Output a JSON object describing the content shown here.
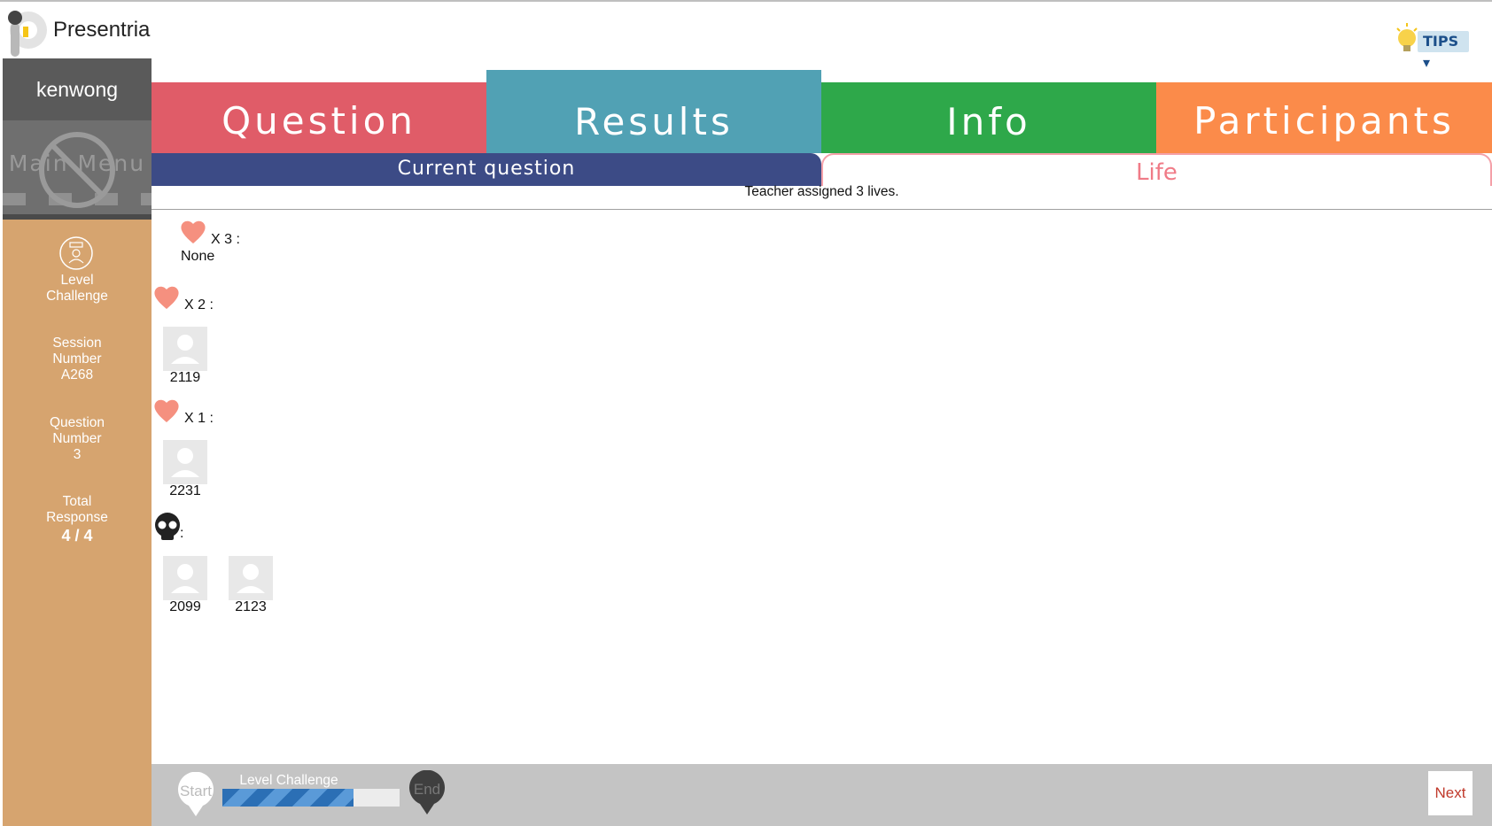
{
  "app": {
    "brand": "Presentria",
    "tips_label": "TIPS ▾"
  },
  "sidebar": {
    "username": "kenwong",
    "main_menu": "Main Menu",
    "items": [
      {
        "line1": "Level",
        "line2": "Challenge",
        "line3": ""
      },
      {
        "line1": "Session",
        "line2": "Number",
        "line3": "A268"
      },
      {
        "line1": "Question",
        "line2": "Number",
        "line3": "3"
      },
      {
        "line1": "Total",
        "line2": "Response",
        "line3": "4 / 4"
      }
    ]
  },
  "tabs": {
    "question": "Question",
    "results": "Results",
    "info": "Info",
    "participants": "Participants"
  },
  "subtabs": {
    "current": "Current question",
    "life": "Life"
  },
  "assigned_text": "Teacher assigned 3 lives.",
  "groups": {
    "x3": {
      "label": "X 3 :",
      "empty": "None"
    },
    "x2": {
      "label": "X 2 :",
      "participants": [
        "2119"
      ]
    },
    "x1": {
      "label": "X 1 :",
      "participants": [
        "2231"
      ]
    },
    "dead": {
      "label": ":",
      "participants": [
        "2099",
        "2123"
      ]
    }
  },
  "bottom": {
    "start": "Start",
    "end": "End",
    "progress_label": "Level Challenge",
    "progress_fraction": 0.74,
    "next": "Next"
  },
  "colors": {
    "question_tab": "#e05c68",
    "results_tab": "#51a1b4",
    "info_tab": "#2ea84a",
    "participants_tab": "#fb8b4a",
    "sidebar": "#d6a46f",
    "heart": "#f5907f"
  }
}
